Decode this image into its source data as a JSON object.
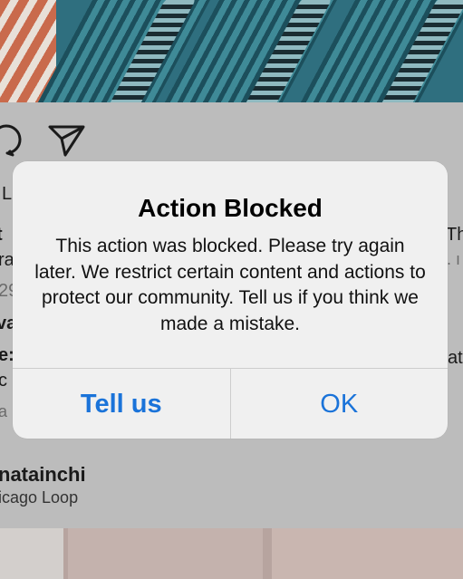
{
  "alert": {
    "title": "Action Blocked",
    "message": "This action was blocked. Please try again later. We restrict certain content and actions to protect our community. Tell us if you think we made a mistake.",
    "buttons": {
      "tell_us": "Tell us",
      "ok": "OK"
    }
  },
  "feed": {
    "next_post_username": "natainchi",
    "next_post_location": "icago Loop",
    "partial_left": [
      "L",
      "t",
      "ra",
      "29",
      "va",
      "e:",
      "c",
      "a"
    ],
    "partial_right": [
      "Th",
      ". ı",
      "at"
    ],
    "icons": [
      "comment-icon",
      "share-icon"
    ]
  }
}
